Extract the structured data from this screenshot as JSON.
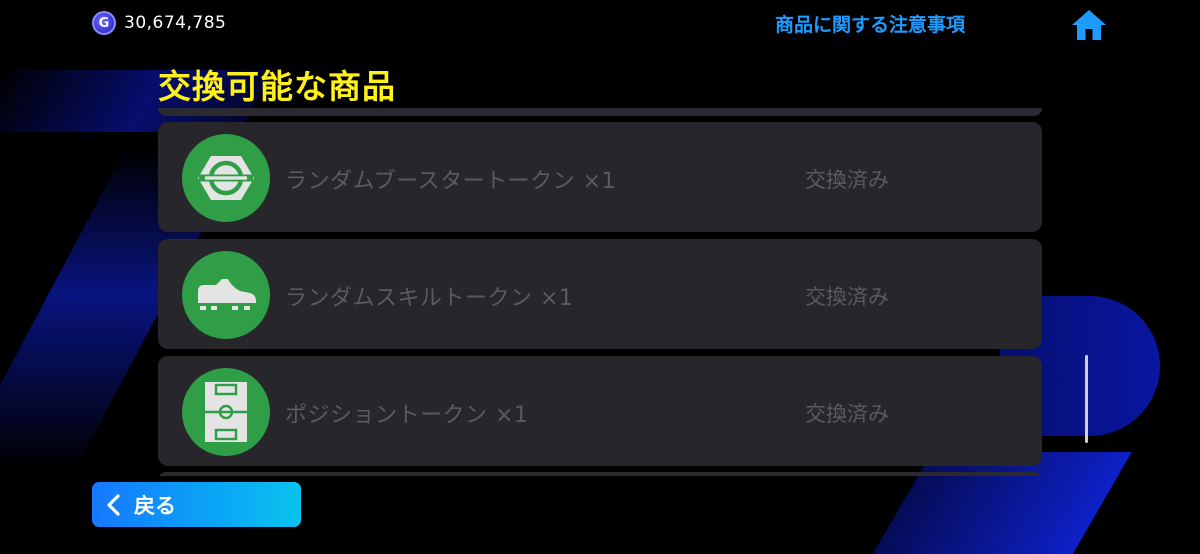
{
  "header": {
    "coin_symbol": "G",
    "coin_amount": "30,674,785",
    "notice_link": "商品に関する注意事項",
    "home_icon": "home-icon"
  },
  "section_title": "交換可能な商品",
  "items": [
    {
      "name": "ランダムブースタートークン ×1",
      "status": "交換済み",
      "icon": "booster-token-icon"
    },
    {
      "name": "ランダムスキルトークン ×1",
      "status": "交換済み",
      "icon": "skill-token-icon"
    },
    {
      "name": "ポジショントークン ×1",
      "status": "交換済み",
      "icon": "position-token-icon"
    }
  ],
  "back_button": {
    "label": "戻る",
    "icon": "chevron-left-icon"
  },
  "colors": {
    "accent_blue": "#1e9bff",
    "title_yellow": "#fff21a",
    "icon_green": "#2f9e47",
    "card_bg": "#26262b",
    "muted_text": "#5a5a60"
  }
}
